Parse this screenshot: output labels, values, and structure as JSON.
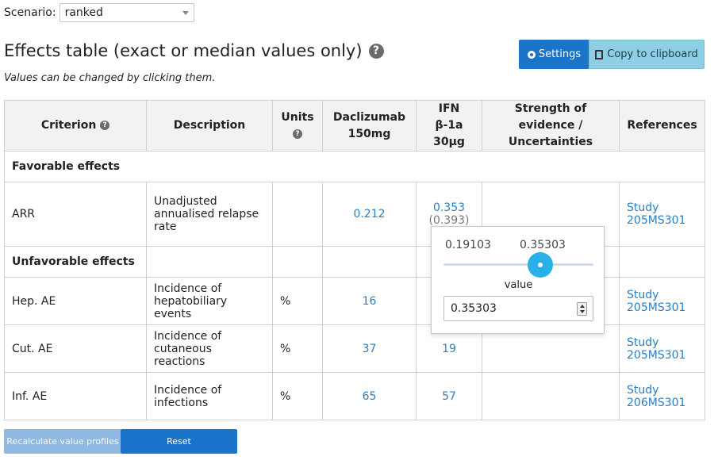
{
  "scenario": {
    "label": "Scenario:",
    "value": "ranked"
  },
  "header": {
    "title": "Effects table (exact or median values only)",
    "help_glyph": "?",
    "subtitle": "Values can be changed by clicking them.",
    "settings_label": "Settings",
    "copy_label": "Copy to clipboard"
  },
  "table": {
    "columns": {
      "criterion": "Criterion",
      "description": "Description",
      "units": "Units",
      "daclizumab": "Daclizumab 150mg",
      "ifn": "IFN β-1a 30μg",
      "strength": "Strength of evidence / Uncertainties",
      "references": "References"
    },
    "favorable_label": "Favorable effects",
    "unfavorable_label": "Unfavorable effects",
    "rows": [
      {
        "criterion": "ARR",
        "description": "Unadjusted annualised relapse rate",
        "units": "",
        "daclizumab": "0.212",
        "ifn": "0.353",
        "ifn_original": "(0.393)",
        "reference": "Study 205MS301"
      },
      {
        "criterion": "Hep. AE",
        "description": "Incidence of hepatobiliary events",
        "units": "%",
        "daclizumab": "16",
        "ifn": "",
        "reference": "Study 205MS301"
      },
      {
        "criterion": "Cut. AE",
        "description": "Incidence of cutaneous reactions",
        "units": "%",
        "daclizumab": "37",
        "ifn": "19",
        "reference": "Study 205MS301"
      },
      {
        "criterion": "Inf. AE",
        "description": "Incidence of infections",
        "units": "%",
        "daclizumab": "65",
        "ifn": "57",
        "reference": "Study 206MS301"
      }
    ]
  },
  "popover": {
    "slider_min": "0.19103",
    "slider_current": "0.35303",
    "caption": "value",
    "input_value": "0.35303"
  },
  "footer": {
    "recalc_label": "Recalculate value profiles",
    "reset_label": "Reset"
  },
  "colors": {
    "primary": "#1b74c9",
    "info": "#8fcfe6",
    "link": "#2a7fc4",
    "slider": "#29b0e8"
  }
}
